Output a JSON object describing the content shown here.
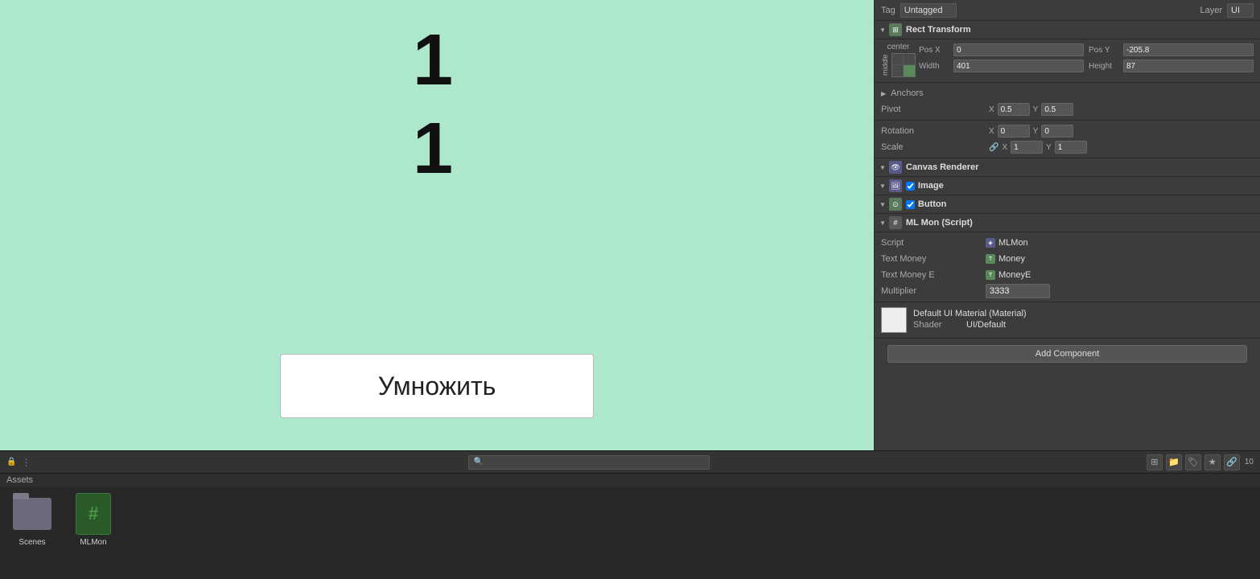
{
  "header": {
    "tag_label": "Tag",
    "tag_value": "Untagged",
    "layer_label": "Layer",
    "layer_value": "UI"
  },
  "rect_transform": {
    "title": "Rect Transform",
    "layout_center": "center",
    "layout_middle": "middle",
    "pos_x_label": "Pos X",
    "pos_x_value": "0",
    "pos_y_label": "Pos Y",
    "pos_y_value": "-205.8",
    "width_label": "Width",
    "width_value": "401",
    "height_label": "Height",
    "height_value": "87"
  },
  "anchors": {
    "title": "Anchors",
    "pivot_label": "Pivot",
    "pivot_x": "0.5",
    "pivot_y": "0.5"
  },
  "rotation": {
    "title": "Rotation",
    "x_label": "X",
    "x_value": "0",
    "y_label": "Y",
    "y_value": "0"
  },
  "scale": {
    "title": "Scale",
    "link_icon": "🔗",
    "x_label": "X",
    "x_value": "1",
    "y_label": "Y",
    "y_value": "1"
  },
  "canvas_renderer": {
    "title": "Canvas Renderer"
  },
  "image": {
    "title": "Image",
    "checked": true
  },
  "button": {
    "title": "Button",
    "checked": true
  },
  "ml_mon_script": {
    "title": "ML Mon (Script)",
    "script_label": "Script",
    "script_value": "MLMon",
    "text_money_label": "Text Money",
    "text_money_value": "Money",
    "text_money_e_label": "Text Money E",
    "text_money_e_value": "MoneyE",
    "multiplier_label": "Multiplier",
    "multiplier_value": "3333"
  },
  "material": {
    "title": "Default UI Material (Material)",
    "shader_label": "Shader",
    "shader_value": "UI/Default"
  },
  "add_component": {
    "label": "Add Component"
  },
  "game_view": {
    "number1_top": "1",
    "number1_bottom": "1",
    "button_label": "Умножить"
  },
  "assets": {
    "title": "Assets",
    "search_placeholder": "",
    "items": [
      {
        "name": "Scenes",
        "type": "folder"
      },
      {
        "name": "MLMon",
        "type": "script"
      }
    ],
    "toolbar": {
      "count": "10"
    }
  }
}
